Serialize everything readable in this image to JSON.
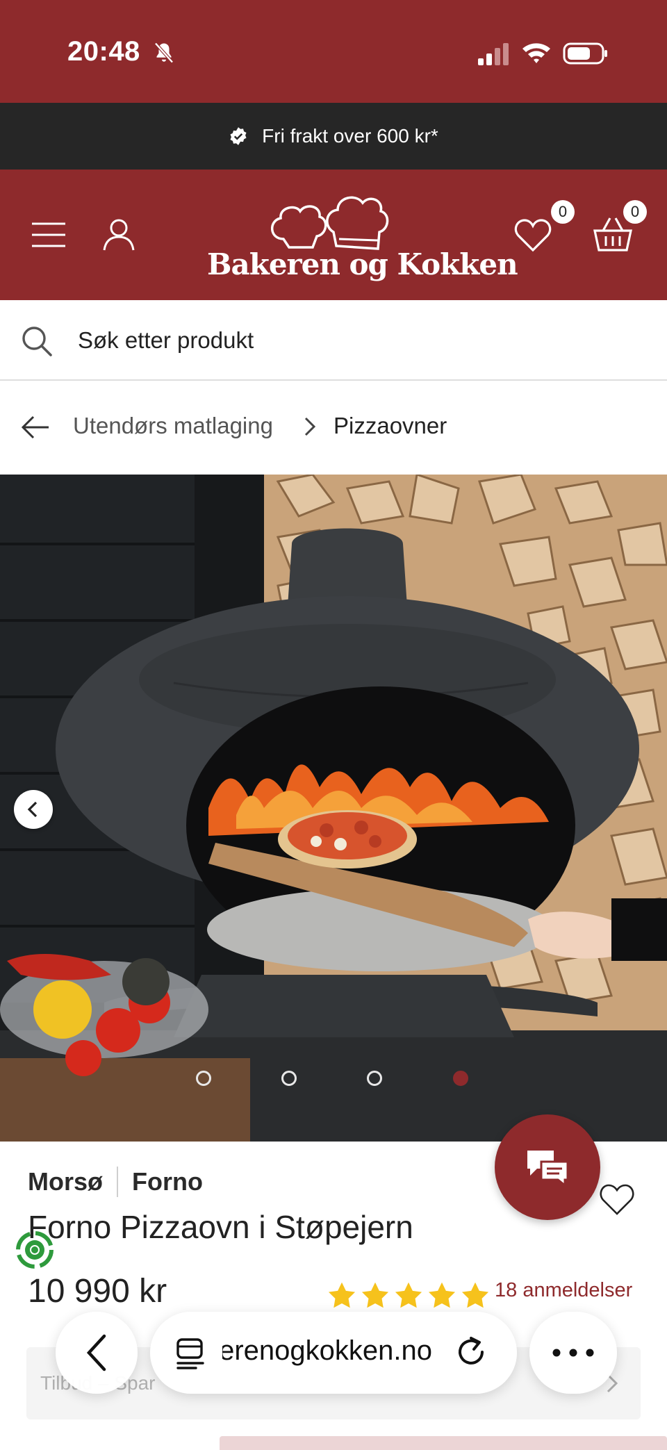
{
  "status_bar": {
    "time": "20:48",
    "icons": [
      "bell-slash-icon",
      "cellular-signal-icon",
      "wifi-icon",
      "battery-icon"
    ]
  },
  "promo": {
    "text": "Fri frakt over 600 kr*"
  },
  "header": {
    "logo_text": "Bakeren og Kokken",
    "wishlist_count": "0",
    "cart_count": "0",
    "colors": {
      "brand": "#8e2a2c",
      "promo_bg": "#262626"
    }
  },
  "search": {
    "placeholder": "Søk etter produkt"
  },
  "breadcrumb": {
    "items": [
      "Utendørs matlaging",
      "Pizzaovner"
    ]
  },
  "gallery": {
    "image_count": 4,
    "active_index": 3
  },
  "product": {
    "brand": "Morsø",
    "series": "Forno",
    "title": "Forno Pizzaovn i Støpejern",
    "price": "10 990 kr",
    "rating": 5,
    "reviews": "18 anmeldelser",
    "offer_text": "Tilbud – Spar"
  },
  "browser": {
    "url": "bakerenogkokken.no"
  }
}
